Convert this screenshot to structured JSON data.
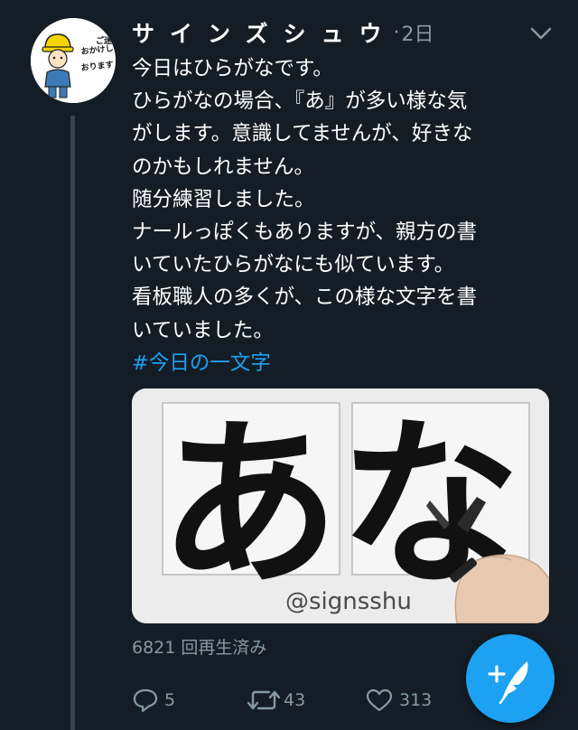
{
  "tweet": {
    "display_name": "サインズシュウ",
    "separator": "·",
    "timestamp": "2日",
    "text_lines": [
      "今日はひらがなです。",
      "ひらがなの場合、『あ』が多い様な気",
      "がします。意識してませんが、好きな",
      "のかもしれません。",
      "随分練習しました。",
      "ナールっぽくもありますが、親方の書",
      "いていたひらがなにも似ています。",
      "看板職人の多くが、この様な文字を書",
      "いていました。"
    ],
    "hashtag": "#今日の一文字"
  },
  "avatar": {
    "sign_text": "ご迷惑をおかけしております",
    "description": "avatar"
  },
  "media": {
    "characters": "あな",
    "watermark": "@signsshu"
  },
  "views": "6821 回再生済み",
  "actions": {
    "reply_count": "5",
    "retweet_count": "43",
    "like_count": "313"
  },
  "colors": {
    "background": "#141d26",
    "text": "#ffffff",
    "muted": "#8899a6",
    "accent": "#1da1f2",
    "thread_line": "#3a444f"
  },
  "icons": {
    "caret": "chevron-down-icon",
    "reply": "reply-icon",
    "retweet": "retweet-icon",
    "like": "heart-icon",
    "compose": "compose-tweet-icon"
  }
}
